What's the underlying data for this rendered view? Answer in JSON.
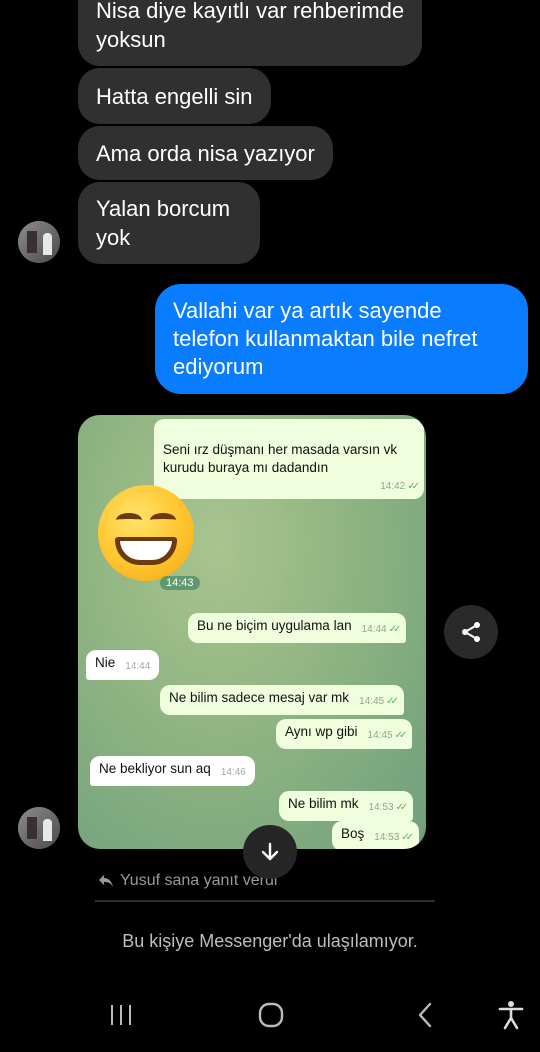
{
  "messages_received": [
    {
      "text": "Nisa diye kayıtlı var rehberimde\nyoksun"
    },
    {
      "text": "Hatta engelli sin"
    },
    {
      "text": "Ama orda nisa yazıyor"
    },
    {
      "text": "Yalan borcum\nyok"
    }
  ],
  "message_sent": {
    "text": "Vallahi var ya artık sayende telefon kullanmaktan bile nefret ediyorum"
  },
  "shared_screenshot": {
    "messages": [
      {
        "text": "Seni ırz düşmanı her masada varsın vk\nkurudu buraya mı dadandın",
        "time": "14:42"
      },
      {
        "text": "Bu ne biçim uygulama lan",
        "time": "14:44"
      },
      {
        "text": "Nie",
        "time": "14:44"
      },
      {
        "text": "Ne bilim sadece mesaj var mk",
        "time": "14:45"
      },
      {
        "text": "Aynı wp gibi",
        "time": "14:45"
      },
      {
        "text": "Ne bekliyor sun aq",
        "time": "14:46"
      },
      {
        "text": "Ne bilim mk",
        "time": "14:53"
      },
      {
        "text": "Boş",
        "time": "14:53"
      }
    ],
    "emoji_time": "14:43",
    "emoji_icon": "grinning-face-emoji"
  },
  "reply_note": "Yusuf sana yanıt verdi",
  "unreachable_notice": "Bu kişiye Messenger'da ulaşılamıyor.",
  "colors": {
    "sent_bubble": "#0a7cff",
    "received_bubble": "#303030",
    "background": "#000000"
  },
  "icons": {
    "share": "share-icon",
    "scroll_down": "arrow-down-icon",
    "reply": "reply-icon",
    "nav_recents": "recents-icon",
    "nav_home": "home-icon",
    "nav_back": "back-icon",
    "nav_accessibility": "accessibility-icon"
  }
}
